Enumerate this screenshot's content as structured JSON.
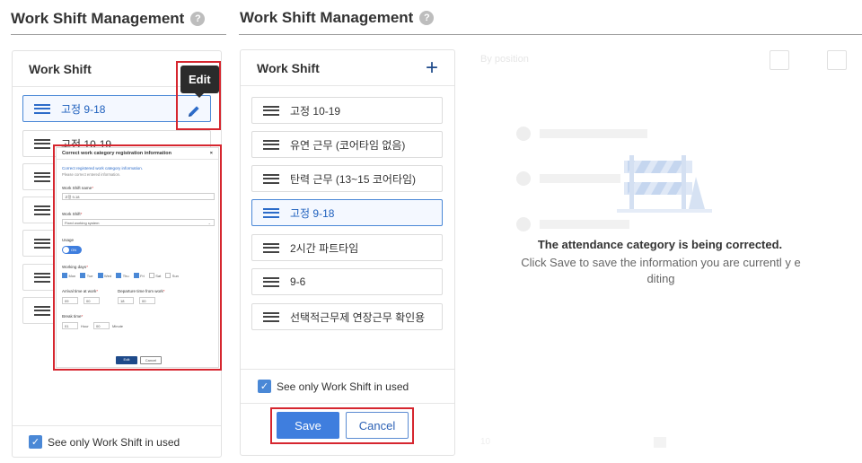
{
  "left_title": "Work Shift Management",
  "right_title": "Work Shift Management",
  "help_glyph": "?",
  "left_panel": {
    "header": "Work Shift",
    "selected_item": "고정 9-18",
    "items": [
      "고정 10-19",
      "",
      "",
      "",
      "",
      ""
    ],
    "tooltip": "Edit",
    "filter_label": "See only Work Shift in used"
  },
  "modal": {
    "title": "Correct work category registration information",
    "close": "×",
    "subtitle1": "Correct registered work category information.",
    "subtitle2": "Please correct entered information.",
    "name_label": "Work Shift name",
    "name_value": "고정 9-18",
    "shift_label": "Work Shift",
    "shift_value": "Fixed working system",
    "usage_label": "Usage",
    "usage_toggle": "ON",
    "days_label": "Working days",
    "days": [
      {
        "label": "Mon",
        "checked": true
      },
      {
        "label": "Tue",
        "checked": true
      },
      {
        "label": "Wed",
        "checked": true
      },
      {
        "label": "Thu",
        "checked": true
      },
      {
        "label": "Fri",
        "checked": true
      },
      {
        "label": "Sat",
        "checked": false
      },
      {
        "label": "Sun",
        "checked": false
      }
    ],
    "arrival_label": "Arrival time at work",
    "departure_label": "Departure time from work",
    "arrival_h": "09",
    "arrival_m": "00",
    "departure_h": "18",
    "departure_m": "00",
    "break_label": "Break time",
    "break_h": "01",
    "break_hour_unit": "Hour",
    "break_m": "00",
    "break_min_unit": "Minute",
    "edit_btn": "Edit",
    "cancel_btn": "Cancel"
  },
  "mid_panel": {
    "header": "Work Shift",
    "plus": "+",
    "items": [
      {
        "label": "고정 10-19",
        "selected": false
      },
      {
        "label": "유연 근무 (코어타임 없음)",
        "selected": false
      },
      {
        "label": "탄력 근무 (13~15 코어타임)",
        "selected": false
      },
      {
        "label": "고정 9-18",
        "selected": true
      },
      {
        "label": "2시간 파트타임",
        "selected": false
      },
      {
        "label": "9-6",
        "selected": false
      },
      {
        "label": "선택적근무제 연장근무 확인용",
        "selected": false
      }
    ],
    "filter_label": "See only Work Shift in used",
    "save_btn": "Save",
    "cancel_btn": "Cancel"
  },
  "right": {
    "filter_label": "By position",
    "message_title": "The attendance category is being corrected.",
    "message_body": "Click Save to save the information you are currentl y editing"
  },
  "colors": {
    "accent": "#3f7ede",
    "highlight": "#d6262f"
  }
}
